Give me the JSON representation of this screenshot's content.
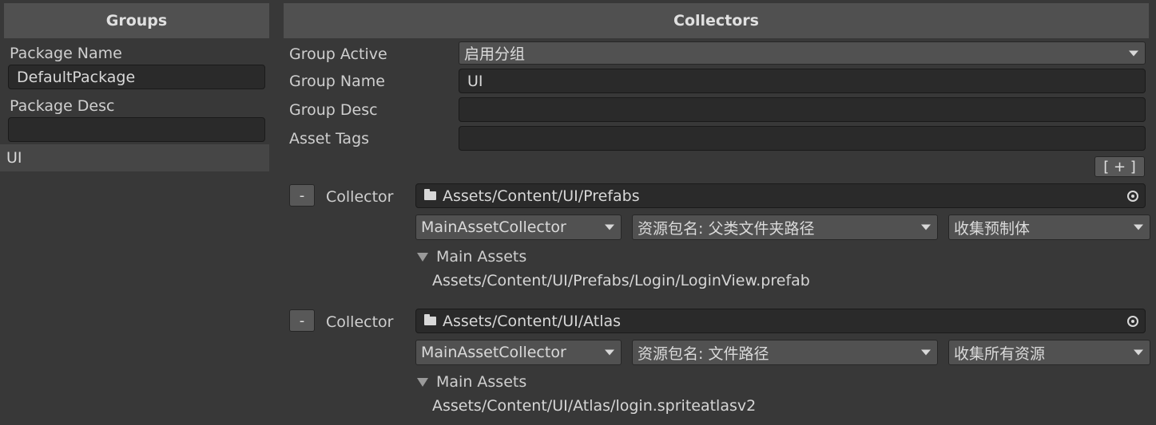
{
  "left": {
    "header": "Groups",
    "package_name_label": "Package Name",
    "package_name_value": "DefaultPackage",
    "package_desc_label": "Package Desc",
    "package_desc_value": "",
    "groups": [
      "UI"
    ]
  },
  "right": {
    "header": "Collectors",
    "group_active_label": "Group Active",
    "group_active_value": "启用分组",
    "group_name_label": "Group Name",
    "group_name_value": "UI",
    "group_desc_label": "Group Desc",
    "group_desc_value": "",
    "asset_tags_label": "Asset Tags",
    "asset_tags_value": "",
    "add_button": "[ + ]",
    "collectors": [
      {
        "remove_label": "-",
        "label": "Collector",
        "path": "Assets/Content/UI/Prefabs",
        "collector_type": "MainAssetCollector",
        "address_rule": "资源包名: 父类文件夹路径",
        "filter_rule": "收集预制体",
        "assets_foldout": "Main Assets",
        "assets": [
          "Assets/Content/UI/Prefabs/Login/LoginView.prefab"
        ]
      },
      {
        "remove_label": "-",
        "label": "Collector",
        "path": "Assets/Content/UI/Atlas",
        "collector_type": "MainAssetCollector",
        "address_rule": "资源包名: 文件路径",
        "filter_rule": "收集所有资源",
        "assets_foldout": "Main Assets",
        "assets": [
          "Assets/Content/UI/Atlas/login.spriteatlasv2"
        ]
      }
    ]
  },
  "icons": {
    "folder": "folder-icon",
    "target": "object-picker-icon",
    "dropdown": "chevron-down-icon",
    "foldout": "foldout-triangle-icon"
  }
}
